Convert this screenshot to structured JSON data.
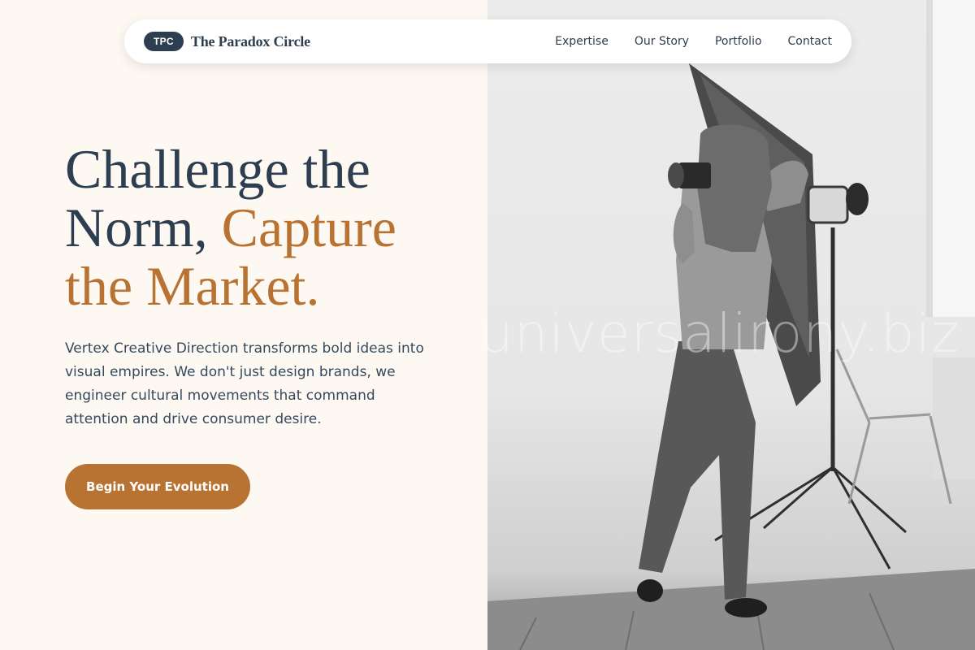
{
  "brand": {
    "badge": "TPC",
    "name": "The Paradox Circle"
  },
  "nav": {
    "links": [
      {
        "label": "Expertise"
      },
      {
        "label": "Our Story"
      },
      {
        "label": "Portfolio"
      },
      {
        "label": "Contact"
      }
    ]
  },
  "hero": {
    "title_line1": "Challenge the",
    "title_line2_plain": "Norm, ",
    "title_line2_accent": "Capture",
    "title_line3_accent": "the Market.",
    "description": "Vertex Creative Direction transforms bold ideas into visual empires. We don't just design brands, we engineer cultural movements that command attention and drive consumer desire.",
    "cta_label": "Begin Your Evolution"
  },
  "photo": {
    "subject": "photographer-with-camera-and-studio-light",
    "watermark": "universalirony.biz"
  },
  "colors": {
    "navy": "#2c3e50",
    "accent": "#b87333",
    "cream": "#fdf8f2"
  }
}
